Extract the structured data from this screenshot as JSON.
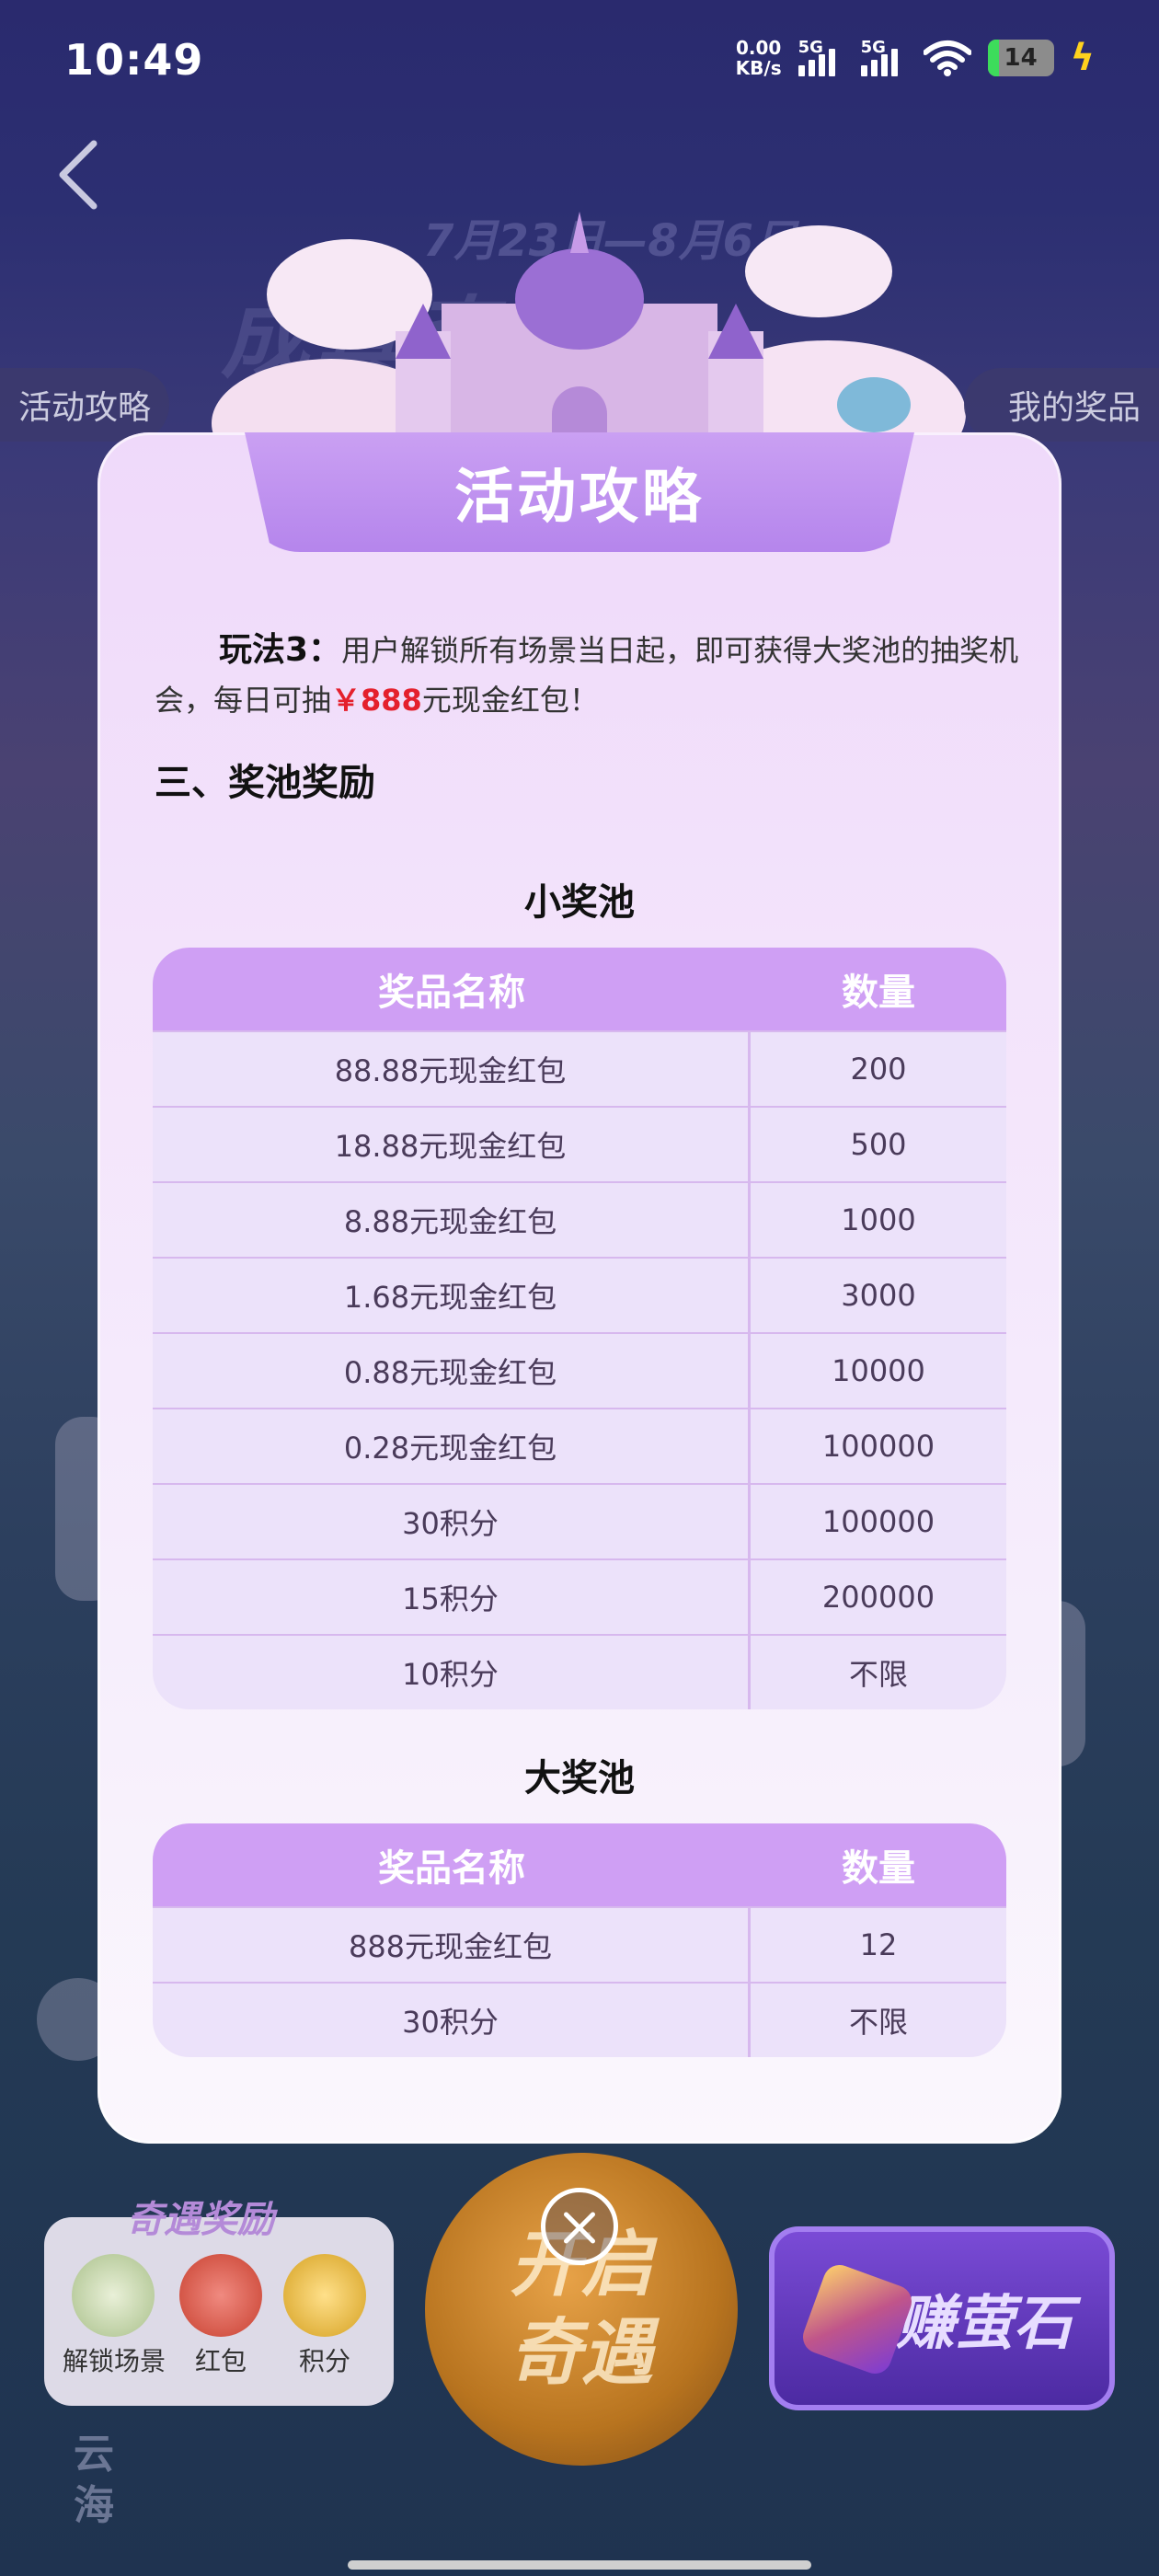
{
  "status_bar": {
    "time": "10:49",
    "net_speed_value": "0.00",
    "net_speed_unit": "KB/s",
    "signal1_label": "5G",
    "signal2_label": "5G",
    "battery": "14"
  },
  "hero": {
    "dates": "7月23日—8月6日",
    "title": "成真奇遇",
    "left_tab": "活动攻略",
    "right_tab": "我的奖品"
  },
  "modal": {
    "title": "活动攻略",
    "rule_label": "玩法3：",
    "rule_text_1": "用户解锁所有场景当日起，即可获得大奖池的抽奖机会，每日可抽",
    "rule_highlight": "￥888",
    "rule_text_2": "元现金红包！",
    "section_title": "三、奖池奖励",
    "small_pool": {
      "title": "小奖池",
      "headers": [
        "奖品名称",
        "数量"
      ],
      "rows": [
        [
          "88.88元现金红包",
          "200"
        ],
        [
          "18.88元现金红包",
          "500"
        ],
        [
          "8.88元现金红包",
          "1000"
        ],
        [
          "1.68元现金红包",
          "3000"
        ],
        [
          "0.88元现金红包",
          "10000"
        ],
        [
          "0.28元现金红包",
          "100000"
        ],
        [
          "30积分",
          "100000"
        ],
        [
          "15积分",
          "200000"
        ],
        [
          "10积分",
          "不限"
        ]
      ]
    },
    "big_pool": {
      "title": "大奖池",
      "headers": [
        "奖品名称",
        "数量"
      ],
      "rows": [
        [
          "888元现金红包",
          "12"
        ],
        [
          "30积分",
          "不限"
        ]
      ]
    }
  },
  "bottom": {
    "reward_title": "奇遇奖励",
    "reward_items": [
      "解锁场景",
      "红包",
      "积分"
    ],
    "open_button": "开启奇遇",
    "earn_button": "赚萤石",
    "side_text": "云海"
  }
}
